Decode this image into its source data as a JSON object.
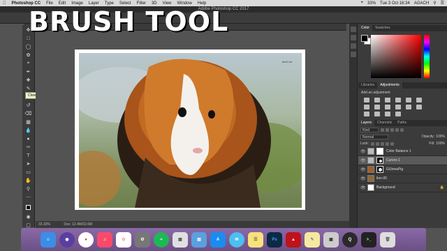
{
  "menubar": {
    "apple": "",
    "app_name": "Photoshop CC",
    "items": [
      "File",
      "Edit",
      "Image",
      "Layer",
      "Type",
      "Select",
      "Filter",
      "3D",
      "View",
      "Window",
      "Help"
    ],
    "battery": "33%",
    "clock": "Tue 3 Oct 16:34",
    "user": "AGACH"
  },
  "window_title": "Adobe Photoshop CC 2017",
  "document_tab": "Mask/8) *",
  "document_tab_suffix": "(RGB/8) *",
  "heading": "BRUSH TOOL",
  "tooltip": "Clone Stamp Tool (S)",
  "watermark": "don't mi",
  "status": {
    "zoom": "33.33%",
    "doc": "Doc: 12.4M/32.6M"
  },
  "panels": {
    "color_tabs": [
      "Color",
      "Swatches"
    ],
    "libraries_tabs": [
      "Libraries",
      "Adjustments"
    ],
    "add_adjustment": "Add an adjustment",
    "layers_tabs": [
      "Layers",
      "Channels",
      "Paths"
    ],
    "filter_kind": "Kind",
    "blend_mode": "Normal",
    "opacity_label": "Opacity:",
    "opacity_value": "100%",
    "lock_label": "Lock:",
    "fill_label": "Fill:",
    "fill_value": "100%"
  },
  "layers": [
    {
      "name": "Color Balance 1",
      "type": "adjustment",
      "mask": "white",
      "selected": false
    },
    {
      "name": "Curves 1",
      "type": "adjustment",
      "mask": "black",
      "selected": true
    },
    {
      "name": "GUineaPig",
      "type": "image",
      "mask": "black",
      "selected": false
    },
    {
      "name": "lion-05",
      "type": "image",
      "mask": "",
      "selected": false
    },
    {
      "name": "Background",
      "type": "background",
      "mask": "",
      "selected": false
    }
  ],
  "dock_apps": [
    "Finder",
    "Siri",
    "Chrome",
    "Music",
    "Photos",
    "System Preferences",
    "Spotify",
    "Launchpad",
    "Preview",
    "App Store",
    "Messages",
    "Notes",
    "Photoshop",
    "Acrobat",
    "Stickies",
    "Preview",
    "QuickTime",
    "Terminal",
    "Trash"
  ]
}
